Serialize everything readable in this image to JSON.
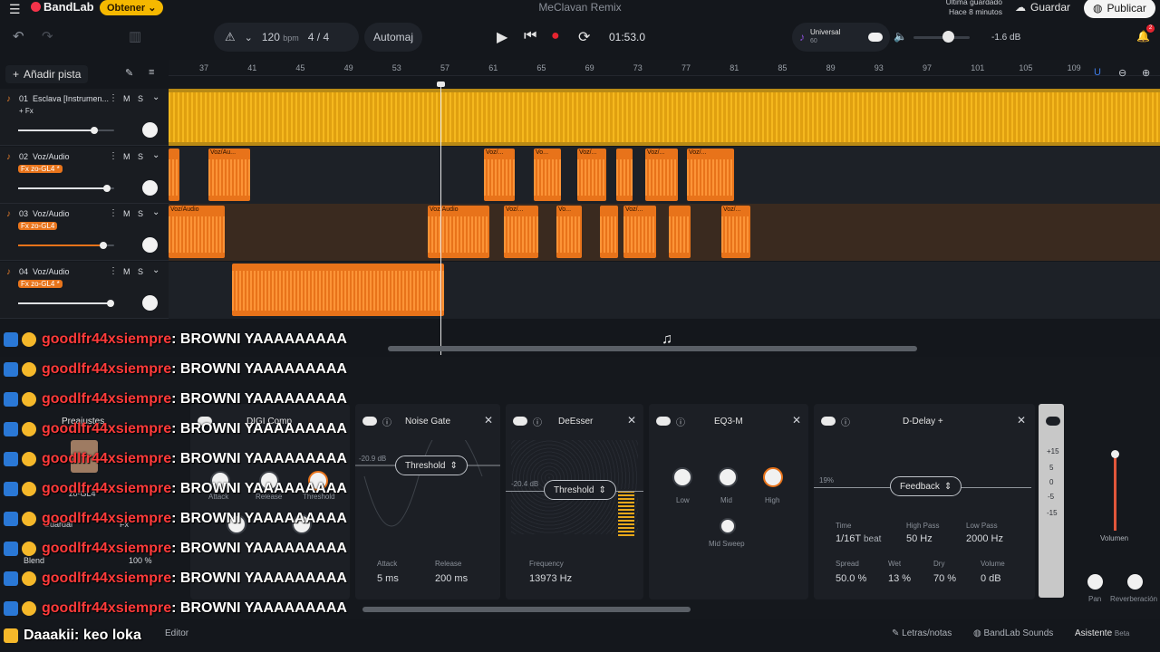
{
  "header": {
    "brand": "BandLab",
    "obtener_label": "Obtener",
    "project_title": "MeClavan Remix",
    "saved_line1": "Última guardado",
    "saved_line2": "Hace 8 minutos",
    "guardar_label": "Guardar",
    "publicar_label": "Publicar"
  },
  "toolbar": {
    "bpm_value": "120",
    "bpm_unit": "bpm",
    "time_signature": "4 / 4",
    "auto_label": "Automaj",
    "time": "01:53.0",
    "instrument_name": "Universal",
    "instrument_sub": "60",
    "master_db": "-1.6 dB",
    "notification_count": "2"
  },
  "tracks_panel": {
    "add_track_label": "Añadir pista",
    "ruler": [
      "37",
      "41",
      "45",
      "49",
      "53",
      "57",
      "61",
      "65",
      "69",
      "73",
      "77",
      "81",
      "85",
      "89",
      "93",
      "97",
      "101",
      "105",
      "109"
    ],
    "tracks": [
      {
        "num": "01",
        "name": "Esclava [Instrumen...",
        "fx": "+ Fx",
        "m": "M",
        "s": "S"
      },
      {
        "num": "02",
        "name": "Voz/Audio",
        "fx": "Fx zo-GL4 *",
        "m": "M",
        "s": "S"
      },
      {
        "num": "03",
        "name": "Voz/Audio",
        "fx": "Fx zo-GL4",
        "m": "M",
        "s": "S"
      },
      {
        "num": "04",
        "name": "Voz/Audio",
        "fx": "Fx zo-GL4 *",
        "m": "M",
        "s": "S"
      }
    ],
    "clip_labels": {
      "t2": [
        "Voz/Au...",
        "Voz/...",
        "Vo...",
        "Voz/...",
        "Voz/...",
        "Voz/..."
      ],
      "t3": [
        "Voz/Audio",
        "Voz/Audio",
        "Voz/...",
        "Vo...",
        "Voz/...",
        "Voz/..."
      ]
    }
  },
  "effects": {
    "presets_label": "Preajustes",
    "preset_name": "zo-GL4",
    "save_label": "Guardar",
    "fx_label": "Fx",
    "blend_label": "Blend",
    "blend_value": "100 %",
    "digi_comp": "DIGI Comp",
    "comp_knobs": [
      "Attack",
      "Release",
      "Threshold"
    ],
    "noise_gate": {
      "title": "Noise Gate",
      "threshold_btn": "Threshold",
      "db_label": "-20.9 dB",
      "attack_label": "Attack",
      "attack_val": "5 ms",
      "release_label": "Release",
      "release_val": "200 ms"
    },
    "deesser": {
      "title": "DeEsser",
      "threshold_btn": "Threshold",
      "db_label": "-20.4 dB",
      "freq_label": "Frequency",
      "freq_val": "13973 Hz"
    },
    "eq": {
      "title": "EQ3-M",
      "low": "Low",
      "mid": "Mid",
      "high": "High",
      "mid_sweep": "Mid Sweep"
    },
    "delay": {
      "title": "D-Delay +",
      "feedback_btn": "Feedback",
      "percent_label": "19%",
      "time_label": "Time",
      "time_val": "1/16T",
      "time_unit": "beat",
      "highpass_label": "High Pass",
      "highpass_val": "50 Hz",
      "lowpass_label": "Low Pass",
      "lowpass_val": "2000 Hz",
      "spread_label": "Spread",
      "spread_val": "50.0 %",
      "wet_label": "Wet",
      "wet_val": "13 %",
      "dry_label": "Dry",
      "dry_val": "70 %",
      "volume_label": "Volume",
      "volume_val": "0 dB"
    },
    "meter": {
      "plus15": "+15",
      "plus5": "5",
      "zero": "0",
      "minus5": "-5",
      "minus15": "-15"
    },
    "volumen_label": "Volumen",
    "pan_label": "Pan",
    "reverb_label": "Reverberación"
  },
  "bottombar": {
    "editor_label": "Editor",
    "letras_label": "Letras/notas",
    "sounds_label": "BandLab Sounds",
    "asistente_label": "Asistente",
    "beta_label": "Beta"
  },
  "chat": {
    "lines": [
      {
        "user": "goodlfr44xsiempre",
        "msg": " : BROWNI YAAAAAAAAA"
      },
      {
        "user": "goodlfr44xsiempre",
        "msg": " : BROWNI YAAAAAAAAA"
      },
      {
        "user": "goodlfr44xsiempre",
        "msg": " : BROWNI YAAAAAAAAA"
      },
      {
        "user": "goodlfr44xsiempre",
        "msg": " : BROWNI YAAAAAAAAA"
      },
      {
        "user": "goodlfr44xsiempre",
        "msg": " : BROWNI YAAAAAAAAA"
      },
      {
        "user": "goodlfr44xsiempre",
        "msg": " : BROWNI YAAAAAAAAA"
      },
      {
        "user": "goodlfr44xsiempre",
        "msg": " : BROWNI YAAAAAAAAA"
      },
      {
        "user": "goodlfr44xsiempre",
        "msg": " : BROWNI YAAAAAAAAA"
      },
      {
        "user": "goodlfr44xsiempre",
        "msg": " : BROWNI YAAAAAAAAA"
      },
      {
        "user": "goodlfr44xsiempre",
        "msg": " : BROWNI YAAAAAAAAA"
      }
    ],
    "last_user": "Daaakii",
    "last_msg": " : keo loka"
  }
}
